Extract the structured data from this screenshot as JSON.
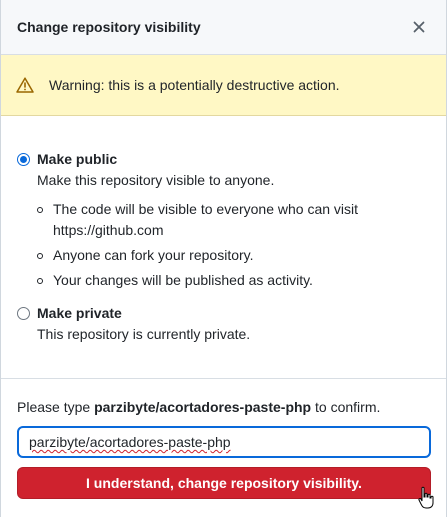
{
  "dialog": {
    "title": "Change repository visibility",
    "close_icon": "close-icon"
  },
  "warning": {
    "icon": "alert-triangle-icon",
    "text": "Warning: this is a potentially destructive action."
  },
  "options": {
    "public": {
      "label": "Make public",
      "description": "Make this repository visible to anyone.",
      "selected": true,
      "bullets": [
        "The code will be visible to everyone who can visit https://github.com",
        "Anyone can fork your repository.",
        "Your changes will be published as activity."
      ]
    },
    "private": {
      "label": "Make private",
      "description": "This repository is currently private.",
      "selected": false
    }
  },
  "confirm": {
    "prefix": "Please type ",
    "repo": "parzibyte/acortadores-paste-php",
    "suffix": " to confirm.",
    "input_value": "parzibyte/acortadores-paste-php",
    "button_label": "I understand, change repository visibility."
  },
  "colors": {
    "accent": "#0969da",
    "danger": "#cf222e",
    "warning_bg": "#fff8c5"
  }
}
